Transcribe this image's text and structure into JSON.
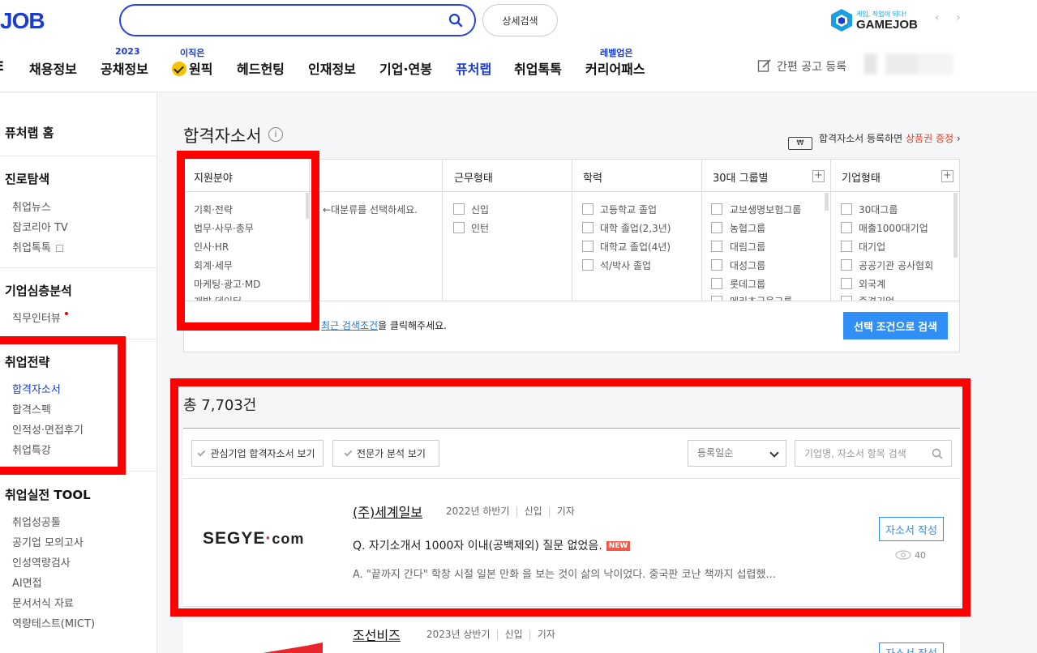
{
  "header": {
    "logo": "JOB",
    "search": {
      "value": "",
      "placeholder": ""
    },
    "advanced_search": "상세검색",
    "gamejob": {
      "tagline": "게임, 직업이 되다!",
      "name": "GAMEJOB",
      "arrows": "‹ ›"
    },
    "nav": [
      {
        "label": "E"
      },
      {
        "label": "채용정보"
      },
      {
        "label": "공채정보",
        "sup": "2023"
      },
      {
        "label": "원픽",
        "sup": "이직은"
      },
      {
        "label": "헤드헌팅"
      },
      {
        "label": "인재정보"
      },
      {
        "label": "기업·연봉"
      },
      {
        "label": "퓨처랩"
      },
      {
        "label": "취업톡톡"
      },
      {
        "label": "커리어패스",
        "sup": "레벨업은"
      }
    ],
    "post_job": "간편 공고 등록"
  },
  "sidebar": {
    "home": "퓨처랩 홈",
    "sections": [
      {
        "title": "진로탐색",
        "items": [
          "취업뉴스",
          "잡코리아 TV",
          "취업톡톡"
        ]
      },
      {
        "title": "기업심층분석",
        "items": [
          "직무인터뷰"
        ]
      },
      {
        "title": "취업전략",
        "items": [
          "합격자소서",
          "합격스펙",
          "인적성·면접후기",
          "취업특강"
        ]
      },
      {
        "title": "취업실전 TOOL",
        "items": [
          "취업성공툴",
          "공기업 모의고사",
          "인성역량검사",
          "AI면접",
          "문서서식 자료",
          "역량테스트(MICT)"
        ]
      }
    ]
  },
  "main": {
    "title": "합격자소서",
    "info_icon": "i",
    "promo": {
      "prefix": "합격자소서 등록하면 ",
      "highlight": "상품권 증정",
      "suffix": " ›",
      "icon": "₩"
    },
    "filters": {
      "field": {
        "title": "지원분야",
        "items": [
          "기획·전략",
          "법무·사무·총무",
          "인사·HR",
          "회계·세무",
          "마케팅·광고·MD",
          "개발·데이터"
        ],
        "hint": "←대분류를 선택하세요."
      },
      "work_type": {
        "title": "근무형태",
        "items": [
          "신입",
          "인턴"
        ]
      },
      "education": {
        "title": "학력",
        "items": [
          "고등학교 졸업",
          "대학 졸업(2,3년)",
          "대학교 졸업(4년)",
          "석/박사 졸업"
        ]
      },
      "group30": {
        "title": "30대 그룹별",
        "items": [
          "교보생명보험그룹",
          "농협그룹",
          "대림그룹",
          "대성그룹",
          "롯데그룹",
          "메리츠금융그룹"
        ]
      },
      "company_type": {
        "title": "기업형태",
        "items": [
          "30대그룹",
          "매출1000대기업",
          "대기업",
          "공공기관 공사협회",
          "외국계",
          "중견기업"
        ]
      }
    },
    "recent_link": "최근 검색조건",
    "recent_suffix": "을 클릭해주세요.",
    "search_button": "선택 조건으로 검색"
  },
  "results": {
    "total": "총 7,703건",
    "toggle_interest": "관심기업 합격자소서 보기",
    "toggle_expert": "전문가 분석 보기",
    "sort": "등록일순",
    "keyword_placeholder": "기업명, 자소서 항목 검색",
    "items": [
      {
        "logo_main": "SEGYE",
        "logo_dot": "·",
        "logo_com": "com",
        "company": "(주)세계일보",
        "period": "2022년 하반기",
        "type": "신입",
        "job": "기자",
        "question": "Q. 자기소개서 1000자 이내(공백제외) 질문 없었음.",
        "new": "NEW",
        "answer": "A. \"끝까지 간다\" 학창 시절 일본 만화 을 보는 것이 삶의 낙이었다. 중국판 코난 책까지 섭렵했...",
        "write": "자소서 작성",
        "views": "40"
      },
      {
        "company": "조선비즈",
        "period": "2023년 상반기",
        "type": "신입",
        "job": "기자",
        "write": "자소서 작성"
      }
    ]
  },
  "colors": {
    "brand": "#1a3cd3",
    "accent_button": "#2f8ff5",
    "highlight_red": "#ff0000",
    "promo_red": "#e8402a"
  }
}
